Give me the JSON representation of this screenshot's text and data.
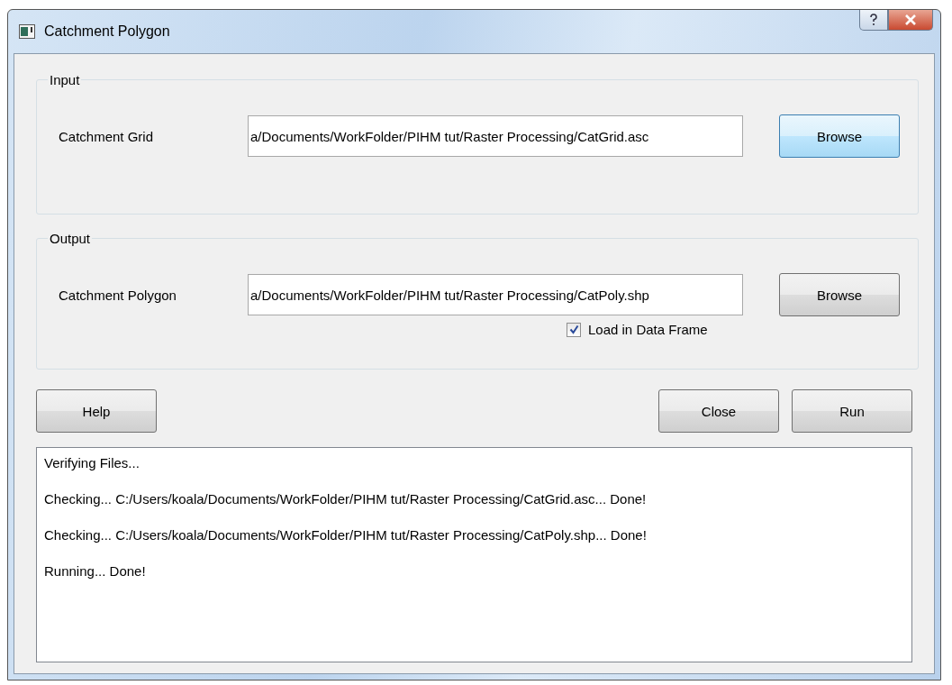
{
  "window": {
    "title": "Catchment Polygon"
  },
  "groups": [
    {
      "title": "Input",
      "rows": [
        {
          "label": "Catchment Grid",
          "value": "a/Documents/WorkFolder/PIHM tut/Raster Processing/CatGrid.asc",
          "button": {
            "label": "Browse",
            "focused": true
          }
        }
      ]
    },
    {
      "title": "Output",
      "rows": [
        {
          "label": "Catchment Polygon",
          "value": "a/Documents/WorkFolder/PIHM tut/Raster Processing/CatPoly.shp",
          "button": {
            "label": "Browse",
            "focused": false
          }
        }
      ],
      "checkbox": {
        "label": "Load in Data Frame",
        "checked": true
      }
    }
  ],
  "buttons": {
    "left": [
      "Help"
    ],
    "right": [
      "Close",
      "Run"
    ]
  },
  "log": [
    "Verifying Files...",
    "Checking... C:/Users/koala/Documents/WorkFolder/PIHM tut/Raster Processing/CatGrid.asc... Done!",
    "Checking... C:/Users/koala/Documents/WorkFolder/PIHM tut/Raster Processing/CatPoly.shp... Done!",
    "Running... Done!"
  ]
}
